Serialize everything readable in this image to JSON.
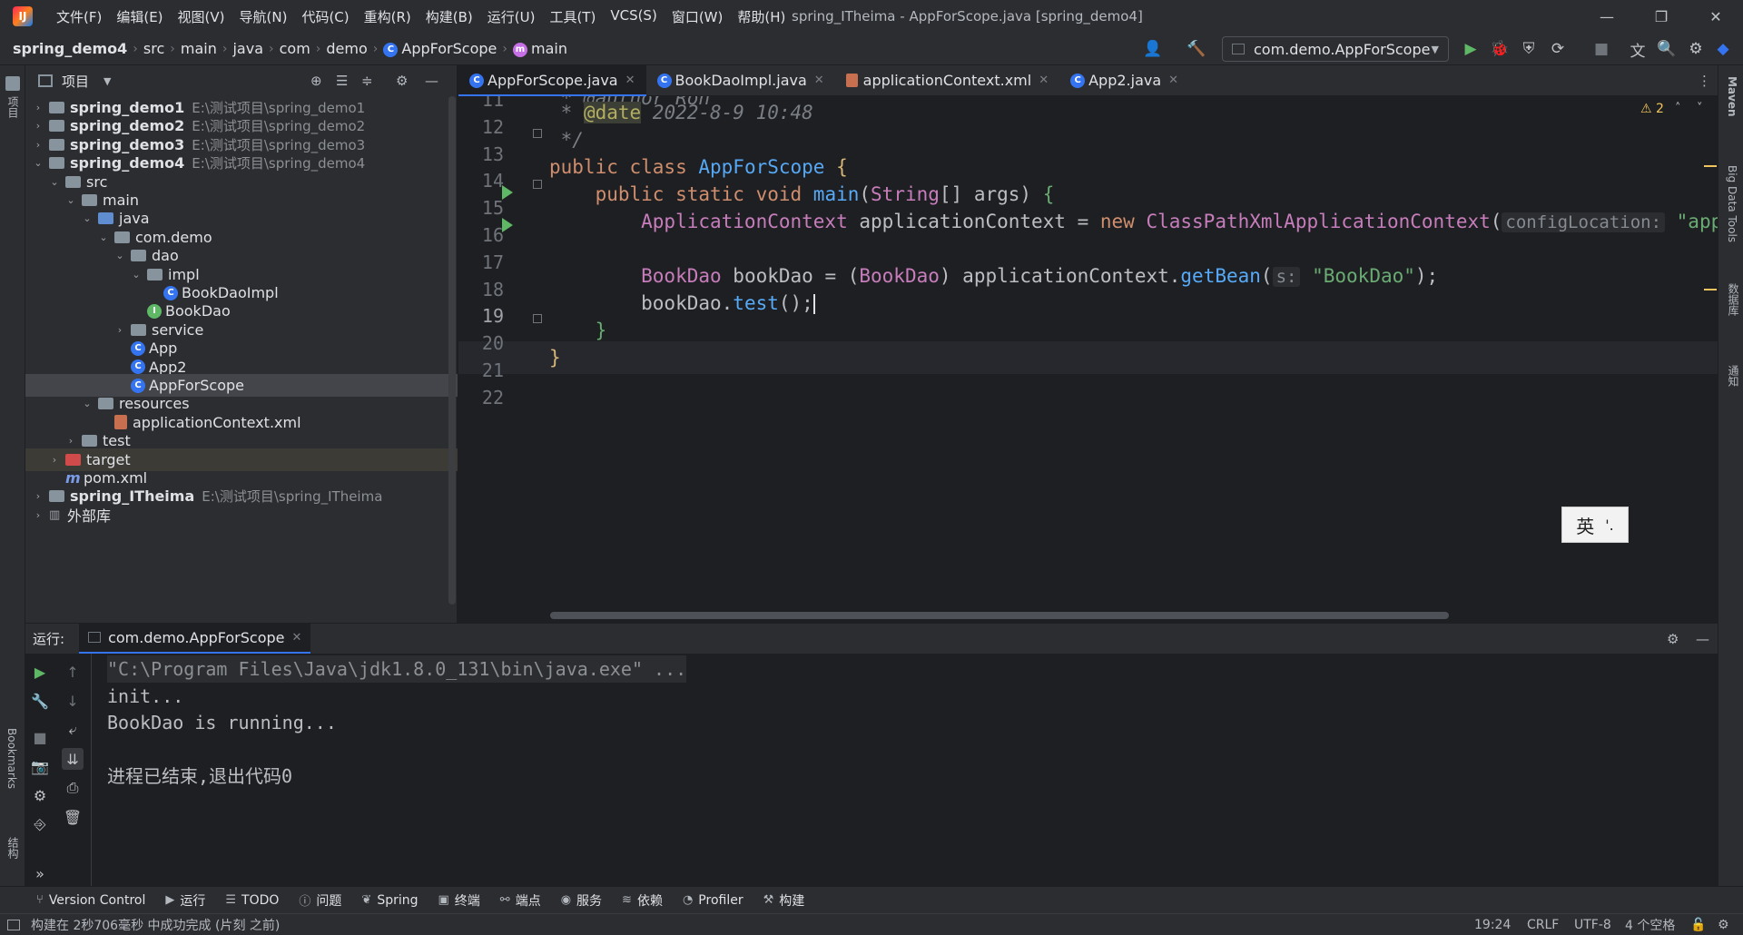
{
  "window": {
    "title": "spring_ITheima - AppForScope.java [spring_demo4]",
    "logo": "IJ",
    "menus": [
      "文件(F)",
      "编辑(E)",
      "视图(V)",
      "导航(N)",
      "代码(C)",
      "重构(R)",
      "构建(B)",
      "运行(U)",
      "工具(T)",
      "VCS(S)",
      "窗口(W)",
      "帮助(H)"
    ]
  },
  "breadcrumbs": [
    "spring_demo4",
    "src",
    "main",
    "java",
    "com",
    "demo",
    "AppForScope",
    "main"
  ],
  "run_config": "com.demo.AppForScope",
  "project_panel": {
    "title": "项目",
    "tree": [
      {
        "label": "spring_demo1",
        "path": "E:\\测试项目\\spring_demo1",
        "depth": 0,
        "arrow": "›",
        "icon": "module-folder",
        "bold": true
      },
      {
        "label": "spring_demo2",
        "path": "E:\\测试项目\\spring_demo2",
        "depth": 0,
        "arrow": "›",
        "icon": "module-folder",
        "bold": true
      },
      {
        "label": "spring_demo3",
        "path": "E:\\测试项目\\spring_demo3",
        "depth": 0,
        "arrow": "›",
        "icon": "module-folder",
        "bold": true
      },
      {
        "label": "spring_demo4",
        "path": "E:\\测试项目\\spring_demo4",
        "depth": 0,
        "arrow": "⌄",
        "icon": "module-folder",
        "bold": true
      },
      {
        "label": "src",
        "path": "",
        "depth": 1,
        "arrow": "⌄",
        "icon": "folder"
      },
      {
        "label": "main",
        "path": "",
        "depth": 2,
        "arrow": "⌄",
        "icon": "folder"
      },
      {
        "label": "java",
        "path": "",
        "depth": 3,
        "arrow": "⌄",
        "icon": "source-folder"
      },
      {
        "label": "com.demo",
        "path": "",
        "depth": 4,
        "arrow": "⌄",
        "icon": "package-folder"
      },
      {
        "label": "dao",
        "path": "",
        "depth": 5,
        "arrow": "⌄",
        "icon": "package-folder"
      },
      {
        "label": "impl",
        "path": "",
        "depth": 6,
        "arrow": "⌄",
        "icon": "package-folder"
      },
      {
        "label": "BookDaoImpl",
        "path": "",
        "depth": 7,
        "arrow": "",
        "icon": "class"
      },
      {
        "label": "BookDao",
        "path": "",
        "depth": 6,
        "arrow": "",
        "icon": "interface"
      },
      {
        "label": "service",
        "path": "",
        "depth": 5,
        "arrow": "›",
        "icon": "package-folder"
      },
      {
        "label": "App",
        "path": "",
        "depth": 5,
        "arrow": "",
        "icon": "class"
      },
      {
        "label": "App2",
        "path": "",
        "depth": 5,
        "arrow": "",
        "icon": "class"
      },
      {
        "label": "AppForScope",
        "path": "",
        "depth": 5,
        "arrow": "",
        "icon": "class",
        "selected": true
      },
      {
        "label": "resources",
        "path": "",
        "depth": 3,
        "arrow": "⌄",
        "icon": "resources-folder"
      },
      {
        "label": "applicationContext.xml",
        "path": "",
        "depth": 4,
        "arrow": "",
        "icon": "xml"
      },
      {
        "label": "test",
        "path": "",
        "depth": 2,
        "arrow": "›",
        "icon": "folder"
      },
      {
        "label": "target",
        "path": "",
        "depth": 1,
        "arrow": "›",
        "icon": "excluded-folder",
        "excluded": true
      },
      {
        "label": "pom.xml",
        "path": "",
        "depth": 1,
        "arrow": "",
        "icon": "maven"
      },
      {
        "label": "spring_ITheima",
        "path": "E:\\测试项目\\spring_ITheima",
        "depth": 0,
        "arrow": "›",
        "icon": "module-folder",
        "bold": true
      },
      {
        "label": "外部库",
        "path": "",
        "depth": 0,
        "arrow": "›",
        "icon": "library"
      }
    ]
  },
  "tabs": [
    {
      "label": "AppForScope.java",
      "active": true,
      "icon": "class"
    },
    {
      "label": "BookDaoImpl.java",
      "active": false,
      "icon": "class"
    },
    {
      "label": "applicationContext.xml",
      "active": false,
      "icon": "xml"
    },
    {
      "label": "App2.java",
      "active": false,
      "icon": "class"
    }
  ],
  "editor": {
    "warnings": "2",
    "lines": [
      {
        "n": "11"
      },
      {
        "n": "12"
      },
      {
        "n": "13"
      },
      {
        "n": "14"
      },
      {
        "n": "15"
      },
      {
        "n": "16"
      },
      {
        "n": "17"
      },
      {
        "n": "18"
      },
      {
        "n": "19"
      },
      {
        "n": "20"
      },
      {
        "n": "21"
      },
      {
        "n": "22"
      }
    ],
    "code": {
      "l11": " * @author Ron",
      "l12_star": " * ",
      "l12_tag": "@date",
      "l12_rest": " 2022-8-9 10:48",
      "l13": " */",
      "l14_kw": "public class ",
      "l14_cls": "AppForScope",
      "l14_br": " {",
      "l15_kw": "    public static void ",
      "l15_fn": "main",
      "l15_p1": "(",
      "l15_type": "String",
      "l15_p2": "[] args) ",
      "l15_br": "{",
      "l16_type": "        ApplicationContext",
      "l16_var": " applicationContext = ",
      "l16_kw": "new ",
      "l16_cls": "ClassPathXmlApplicationContext",
      "l16_p": "(",
      "l16_hint": "configLocation:",
      "l16_str": " \"app",
      "l18_type": "        BookDao",
      "l18_var": " bookDao = (",
      "l18_type2": "BookDao",
      "l18_rest": ") applicationContext.",
      "l18_fn": "getBean",
      "l18_p": "(",
      "l18_hint": "s:",
      "l18_str": " \"BookDao\"",
      "l18_end": ");",
      "l19_var": "        bookDao.",
      "l19_fn": "test",
      "l19_end": "();",
      "l20": "    }",
      "l21": "}"
    }
  },
  "run_panel": {
    "label": "运行:",
    "tab": "com.demo.AppForScope",
    "console": [
      "\"C:\\Program Files\\Java\\jdk1.8.0_131\\bin\\java.exe\" ...",
      "init...",
      "BookDao is running...",
      "",
      "进程已结束,退出代码0"
    ]
  },
  "bottom_tools": [
    {
      "label": "Version Control",
      "icon": "vcs-icon"
    },
    {
      "label": "运行",
      "icon": "run-icon"
    },
    {
      "label": "TODO",
      "icon": "todo-icon"
    },
    {
      "label": "问题",
      "icon": "problems-icon"
    },
    {
      "label": "Spring",
      "icon": "spring-icon"
    },
    {
      "label": "终端",
      "icon": "terminal-icon"
    },
    {
      "label": "端点",
      "icon": "endpoints-icon"
    },
    {
      "label": "服务",
      "icon": "services-icon"
    },
    {
      "label": "依赖",
      "icon": "dependencies-icon"
    },
    {
      "label": "Profiler",
      "icon": "profiler-icon"
    },
    {
      "label": "构建",
      "icon": "build-icon"
    }
  ],
  "status": {
    "message": "构建在 2秒706毫秒 中成功完成 (片刻 之前)",
    "position": "19:24",
    "line_sep": "CRLF",
    "encoding": "UTF-8",
    "indent": "4 个空格"
  },
  "side_labels": {
    "left_top": "项目",
    "left_bookmarks": "Bookmarks",
    "left_structure": "结构",
    "right_maven": "Maven",
    "right_bigdata": "Big Data Tools",
    "right_db": "数据库",
    "right_notify": "通知"
  },
  "ime": {
    "lang": "英",
    "punct": "'."
  }
}
